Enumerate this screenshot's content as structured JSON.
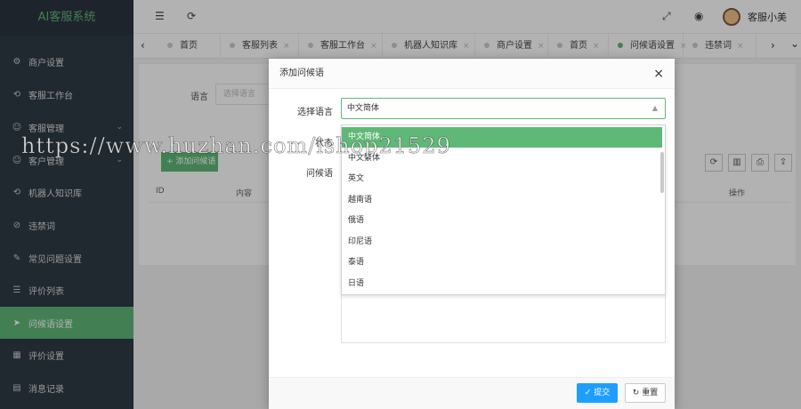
{
  "app": {
    "title": "AI客服系统"
  },
  "sidebar": {
    "items": [
      {
        "label": "商户设置",
        "icon": "gear-icon",
        "glyph": "⚙"
      },
      {
        "label": "客服工作台",
        "icon": "refresh-icon",
        "glyph": "⟲"
      },
      {
        "label": "客服管理",
        "icon": "user-icon",
        "glyph": "☺",
        "expandable": true
      },
      {
        "label": "客户管理",
        "icon": "customer-icon",
        "glyph": "☺",
        "expandable": true
      },
      {
        "label": "机器人知识库",
        "icon": "robot-icon",
        "glyph": "⟲"
      },
      {
        "label": "违禁词",
        "icon": "forbid-icon",
        "glyph": "⊘"
      },
      {
        "label": "常见问题设置",
        "icon": "edit-icon",
        "glyph": "✎"
      },
      {
        "label": "评价列表",
        "icon": "list-icon",
        "glyph": "☰"
      },
      {
        "label": "问候语设置",
        "icon": "send-icon",
        "glyph": "➤",
        "active": true
      },
      {
        "label": "评价设置",
        "icon": "calendar-icon",
        "glyph": "▦"
      },
      {
        "label": "消息记录",
        "icon": "message-icon",
        "glyph": "▤"
      }
    ]
  },
  "header": {
    "menu_icon": "☰",
    "refresh_icon": "⟳",
    "fullscreen_icon": "⤢",
    "theme_icon": "◉",
    "username": "客服小美"
  },
  "tabs": {
    "prev": "‹",
    "next": "›",
    "more": "⌄",
    "close": "×",
    "items": [
      {
        "label": "首页"
      },
      {
        "label": "客服列表"
      },
      {
        "label": "客服工作台"
      },
      {
        "label": "机器人知识库"
      },
      {
        "label": "商户设置"
      },
      {
        "label": "首页"
      },
      {
        "label": "问候语设置",
        "current": true
      },
      {
        "label": "违禁词"
      }
    ]
  },
  "background_page": {
    "language_label": "语言",
    "language_placeholder": "选择语言",
    "add_button": "+ 添加问候语",
    "columns": {
      "id": "ID",
      "content": "内容",
      "action": "操作"
    },
    "toolbar_icons": [
      "⟳",
      "▥",
      "⎙",
      "⇪"
    ]
  },
  "modal": {
    "title": "添加问候语",
    "close": "×",
    "select_language_label": "选择语言",
    "selected_value": "中文简体",
    "status_label": "状态",
    "greeting_label": "问候语",
    "caret": "▲",
    "options": [
      "中文简体",
      "中文繁体",
      "英文",
      "越南语",
      "俄语",
      "印尼语",
      "泰语",
      "日语"
    ],
    "submit": "✓ 提交",
    "reset": "↻ 重置"
  },
  "watermark": "https://www.huzhan.com/ishop21529",
  "colors": {
    "accent": "#5fb878",
    "sidebar": "#2f3a45",
    "primary_button": "#1e9fff"
  }
}
